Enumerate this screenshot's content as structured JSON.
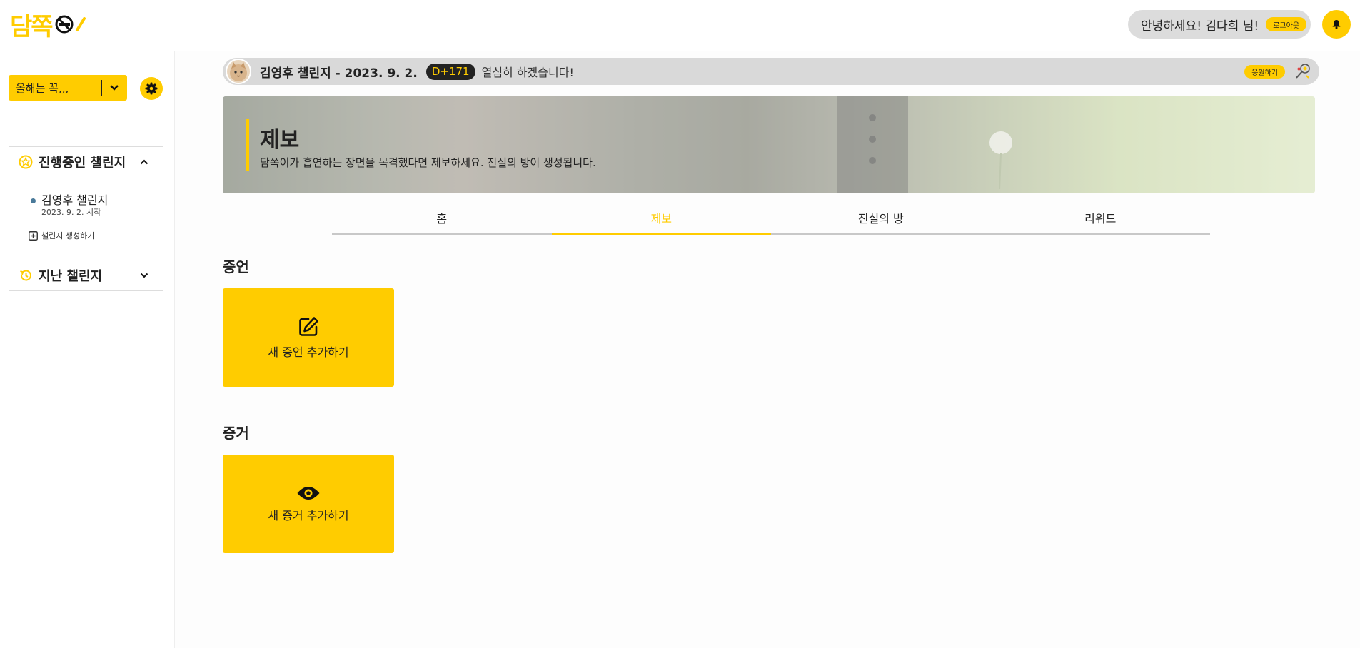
{
  "header": {
    "logo_text": "담쪽",
    "greeting": "안녕하세요! 김다희 님!",
    "logout_label": "로그아웃",
    "accent_color": "#ffcc00"
  },
  "sidebar": {
    "selector_label": "올해는 꼭,,,",
    "active_section_label": "진행중인 챌린지",
    "challenge_name": "김영후 챌린지",
    "challenge_date": "2023. 9. 2. 시작",
    "create_label": "챌린지 생성하기",
    "past_section_label": "지난 챌린지"
  },
  "announcement": {
    "title": "김영후 챌린지 - 2023. 9. 2.",
    "dday": "D+171",
    "message": "열심히 하겠습니다!",
    "cheer_label": "응원하기"
  },
  "banner": {
    "title": "제보",
    "subtitle": "담쪽이가 흡연하는 장면을 목격했다면 제보하세요. 진실의 방이 생성됩니다."
  },
  "tabs": [
    {
      "label": "홈"
    },
    {
      "label": "제보"
    },
    {
      "label": "진실의 방"
    },
    {
      "label": "리워드"
    }
  ],
  "active_tab": "제보",
  "testimony": {
    "title": "증언",
    "button_label": "새 증언 추가하기"
  },
  "evidence": {
    "title": "증거",
    "button_label": "새 증거 추가하기"
  }
}
